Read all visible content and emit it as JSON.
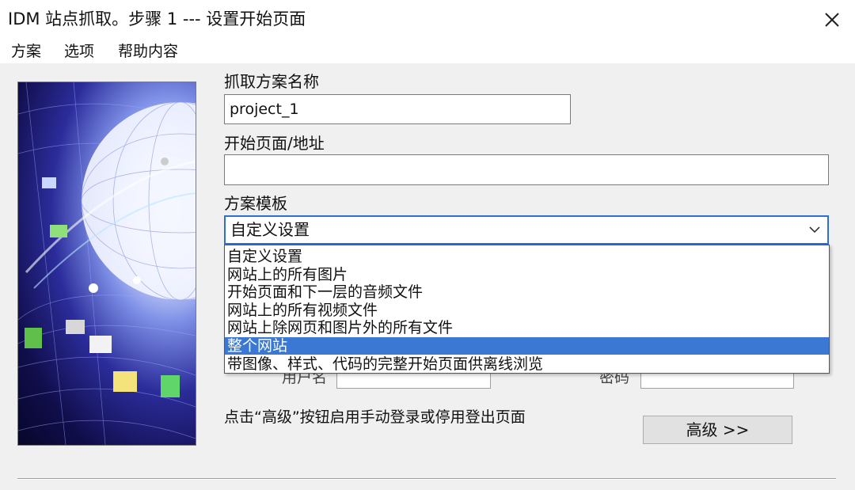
{
  "window": {
    "title": "IDM 站点抓取。步骤 1 --- 设置开始页面"
  },
  "menu": {
    "items": [
      "方案",
      "选项",
      "帮助内容"
    ]
  },
  "form": {
    "project_name_label": "抓取方案名称",
    "project_name_value": "project_1",
    "start_page_label": "开始页面/地址",
    "start_page_value": "",
    "template_label": "方案模板",
    "template_selected": "自定义设置",
    "template_options": [
      "自定义设置",
      "网站上的所有图片",
      "开始页面和下一层的音频文件",
      "网站上的所有视频文件",
      "网站上除网页和图片外的所有文件",
      "整个网站",
      "带图像、样式、代码的完整开始页面供离线浏览"
    ],
    "highlighted_option": "整个网站",
    "partial_label_left": "用户名",
    "partial_label_right": "密码",
    "hint_text": "点击“高级”按钮启用手动登录或停用登出页面",
    "advanced_button_label": "高级 >>"
  },
  "colors": {
    "accent": "#3a78d4",
    "focus_border": "#2e6fd6"
  }
}
